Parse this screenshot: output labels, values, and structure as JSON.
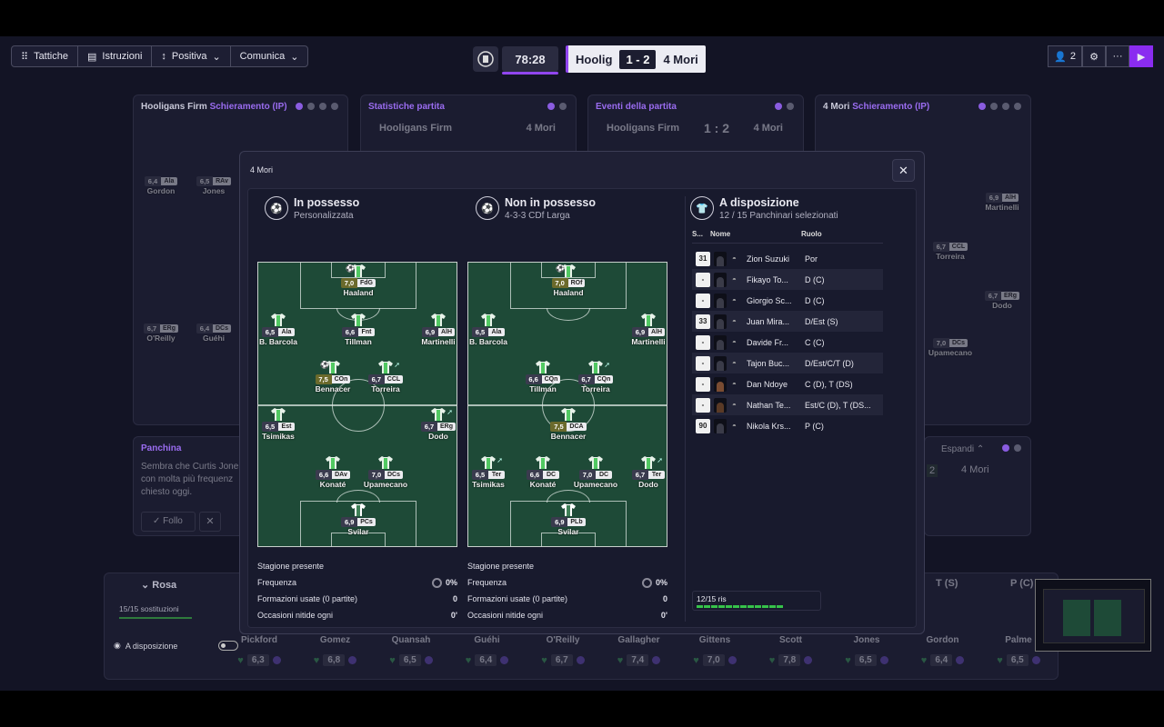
{
  "toolbar": {
    "tactics_label": "Tattiche",
    "instructions_label": "Istruzioni",
    "mentality_label": "Positiva",
    "communication_label": "Comunica"
  },
  "match": {
    "clock": "78:28",
    "home": "Hoolig",
    "score": "1 - 2",
    "away": "4 Mori"
  },
  "topright": {
    "people_count": "2"
  },
  "background": {
    "panel1": {
      "team": "Hooligans Firm",
      "title": "Schieramento (IP)"
    },
    "panel2": {
      "title": "Statistiche partita",
      "home": "Hooligans Firm",
      "away": "4 Mori"
    },
    "panel3": {
      "title": "Eventi della partita",
      "home": "Hooligans Firm",
      "score": "1 : 2",
      "away": "4 Mori"
    },
    "panel4": {
      "team": "4 Mori",
      "title": "Schieramento (IP)"
    },
    "bench": {
      "title": "Panchina",
      "text1": "Sembra che Curtis Jone",
      "text2": "con molta più frequenz",
      "text3": "chiesto oggi.",
      "follow": "Follo"
    },
    "right_extra": {
      "expand": "Espandi",
      "score_small": "2",
      "team": "4 Mori"
    },
    "rosa": {
      "title": "Rosa",
      "subs": "15/15 sostituzioni",
      "toggle_label": "A disposizione"
    },
    "left_players": [
      {
        "name": "Gordon",
        "rating": "6,4",
        "pos": "Ala"
      },
      {
        "name": "Jones",
        "rating": "6,5",
        "pos": "RAv"
      },
      {
        "name": "O'Reilly",
        "rating": "6,7",
        "pos": "ERg"
      },
      {
        "name": "Guéhi",
        "rating": "6,4",
        "pos": "DCs"
      }
    ],
    "right_players": [
      {
        "name": "Martinelli",
        "rating": "6,9",
        "pos": "AlH"
      },
      {
        "name": "Torreira",
        "rating": "6,7",
        "pos": "CCL"
      },
      {
        "name": "Dodo",
        "rating": "6,7",
        "pos": "ERg"
      },
      {
        "name": "Upamecano",
        "rating": "7,0",
        "pos": "DCs"
      }
    ],
    "roster": [
      {
        "name": "Pickford",
        "rating": "6,3"
      },
      {
        "name": "Gomez",
        "rating": "6,8"
      },
      {
        "name": "Quansah",
        "rating": "6,5"
      },
      {
        "name": "Guéhi",
        "rating": "6,4"
      },
      {
        "name": "O'Reilly",
        "rating": "6,7"
      },
      {
        "name": "Gallagher",
        "rating": "7,4"
      },
      {
        "name": "Gittens",
        "rating": "7,0"
      },
      {
        "name": "Scott",
        "rating": "7,8"
      },
      {
        "name": "Jones",
        "rating": "6,5"
      },
      {
        "name": "Gordon",
        "rating": "6,4"
      },
      {
        "name": "Palme",
        "rating": "6,5"
      }
    ],
    "roster_cols": {
      "ts": "T (S)",
      "pc": "P (C)"
    }
  },
  "modal": {
    "title": "4 Mori",
    "in_possession": {
      "title": "In possesso",
      "subtitle": "Personalizzata",
      "season_label": "Stagione presente",
      "freq_label": "Frequenza",
      "freq_value": "0%",
      "forms_label": "Formazioni usate (0 partite)",
      "forms_value": "0",
      "chances_label": "Occasioni nitide ogni",
      "chances_value": "0'",
      "players": [
        {
          "name": "Haaland",
          "rating": "7,0",
          "pos": "FdG",
          "good": true
        },
        {
          "name": "B. Barcola",
          "rating": "6,5",
          "pos": "Ala"
        },
        {
          "name": "Tillman",
          "rating": "6,6",
          "pos": "Fnt"
        },
        {
          "name": "Martinelli",
          "rating": "6,9",
          "pos": "AlH"
        },
        {
          "name": "Bennacer",
          "rating": "7,5",
          "pos": "COn",
          "good": true
        },
        {
          "name": "Torreira",
          "rating": "6,7",
          "pos": "CCL"
        },
        {
          "name": "Tsimikas",
          "rating": "6,5",
          "pos": "Est"
        },
        {
          "name": "Dodo",
          "rating": "6,7",
          "pos": "ERg"
        },
        {
          "name": "Konaté",
          "rating": "6,6",
          "pos": "DAv"
        },
        {
          "name": "Upamecano",
          "rating": "7,0",
          "pos": "DCs"
        },
        {
          "name": "Svilar",
          "rating": "6,9",
          "pos": "PCs"
        }
      ]
    },
    "out_possession": {
      "title": "Non in possesso",
      "subtitle": "4-3-3 CDf Larga",
      "season_label": "Stagione presente",
      "freq_label": "Frequenza",
      "freq_value": "0%",
      "forms_label": "Formazioni usate (0 partite)",
      "forms_value": "0",
      "chances_label": "Occasioni nitide ogni",
      "chances_value": "0'",
      "players": [
        {
          "name": "Haaland",
          "rating": "7,0",
          "pos": "ROf",
          "good": true
        },
        {
          "name": "B. Barcola",
          "rating": "6,5",
          "pos": "Ala"
        },
        {
          "name": "Martinelli",
          "rating": "6,9",
          "pos": "AlH"
        },
        {
          "name": "Tillman",
          "rating": "6,6",
          "pos": "CQn"
        },
        {
          "name": "Torreira",
          "rating": "6,7",
          "pos": "CQn"
        },
        {
          "name": "Bennacer",
          "rating": "7,5",
          "pos": "DCA",
          "good": true
        },
        {
          "name": "Tsimikas",
          "rating": "6,5",
          "pos": "Ter"
        },
        {
          "name": "Konaté",
          "rating": "6,6",
          "pos": "DC"
        },
        {
          "name": "Upamecano",
          "rating": "7,0",
          "pos": "DC"
        },
        {
          "name": "Dodo",
          "rating": "6,7",
          "pos": "Ter"
        },
        {
          "name": "Svilar",
          "rating": "6,9",
          "pos": "PLb"
        }
      ]
    },
    "subs": {
      "title": "A disposizione",
      "subtitle": "12 / 15 Panchinari selezionati",
      "col_s": "S...",
      "col_name": "Nome",
      "col_role": "Ruolo",
      "rows": [
        {
          "num": "31",
          "name": "Zion Suzuki",
          "role": "Por"
        },
        {
          "num": "-",
          "name": "Fikayo To...",
          "role": "D (C)"
        },
        {
          "num": "-",
          "name": "Giorgio Sc...",
          "role": "D (C)"
        },
        {
          "num": "33",
          "name": "Juan Mira...",
          "role": "D/Est (S)"
        },
        {
          "num": "-",
          "name": "Davide Fr...",
          "role": "C (C)"
        },
        {
          "num": "-",
          "name": "Tajon Buc...",
          "role": "D/Est/C/T (D)"
        },
        {
          "num": "-",
          "name": "Dan Ndoye",
          "role": "C (D), T (DS)"
        },
        {
          "num": "-",
          "name": "Nathan Te...",
          "role": "Est/C (D), T (DS..."
        },
        {
          "num": "90",
          "name": "Nikola Krs...",
          "role": "P (C)"
        }
      ],
      "ris_label": "12/15 ris"
    }
  }
}
